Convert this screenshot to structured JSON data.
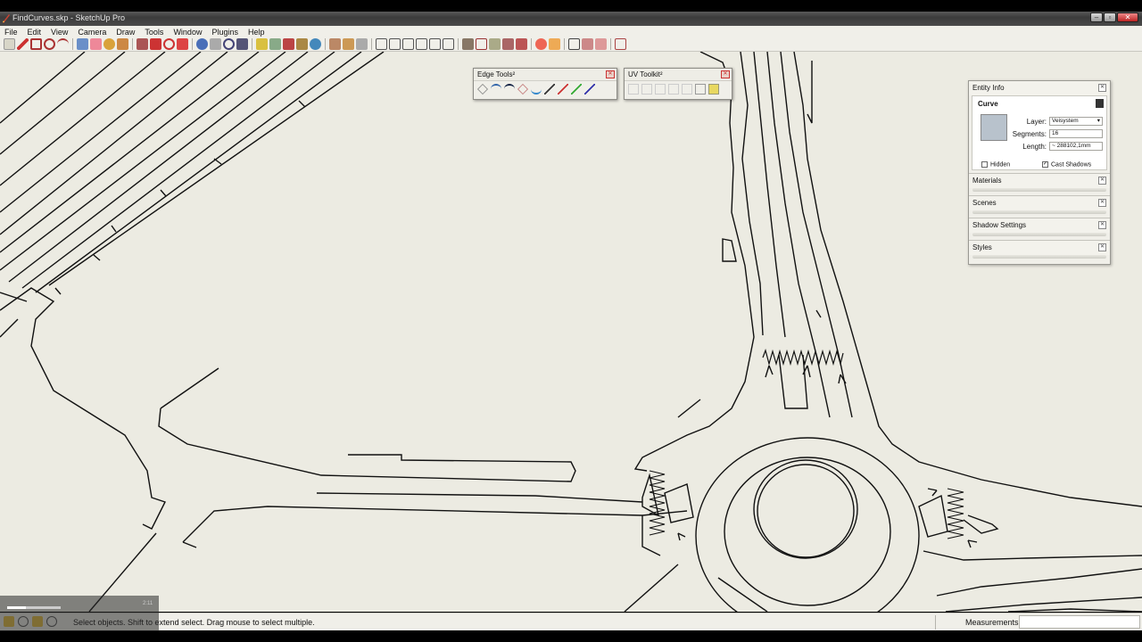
{
  "window": {
    "title": "FindCurves.skp - SketchUp Pro",
    "buttons": [
      "–",
      "▫",
      "✕"
    ]
  },
  "menu": [
    "File",
    "Edit",
    "View",
    "Camera",
    "Draw",
    "Tools",
    "Window",
    "Plugins",
    "Help"
  ],
  "edge_tools": {
    "title": "Edge Tools²",
    "icons": [
      "select-icon",
      "arc-icon",
      "curve-icon",
      "loop-icon",
      "smooth-icon",
      "split-icon",
      "merge-icon",
      "close-gaps-icon",
      "simplify-icon"
    ]
  },
  "uv_toolkit": {
    "title": "UV Toolkit²",
    "icons": [
      "uv-map-icon",
      "uv-align-icon",
      "uv-rotate-icon",
      "uv-scale-icon",
      "uv-edit-icon",
      "uv-export-icon",
      "uv-import-icon"
    ]
  },
  "tray": {
    "entity_info": {
      "title": "Entity Info",
      "kind": "Curve",
      "layer_label": "Layer:",
      "layer_value": "Veisystem",
      "segments_label": "Segments:",
      "segments_value": "16",
      "length_label": "Length:",
      "length_value": "~ 288102,1mm",
      "hidden_label": "Hidden",
      "cast_shadows_label": "Cast Shadows",
      "cast_shadows_checked": true,
      "hidden_checked": false
    },
    "materials": "Materials",
    "scenes": "Scenes",
    "shadow_settings": "Shadow Settings",
    "styles": "Styles"
  },
  "status": {
    "text": "Select objects. Shift to extend select. Drag mouse to select multiple.",
    "measurements_label": "Measurements",
    "measurements_value": ""
  },
  "video_overlay": {
    "time": "2:11",
    "progress": 0.35
  }
}
